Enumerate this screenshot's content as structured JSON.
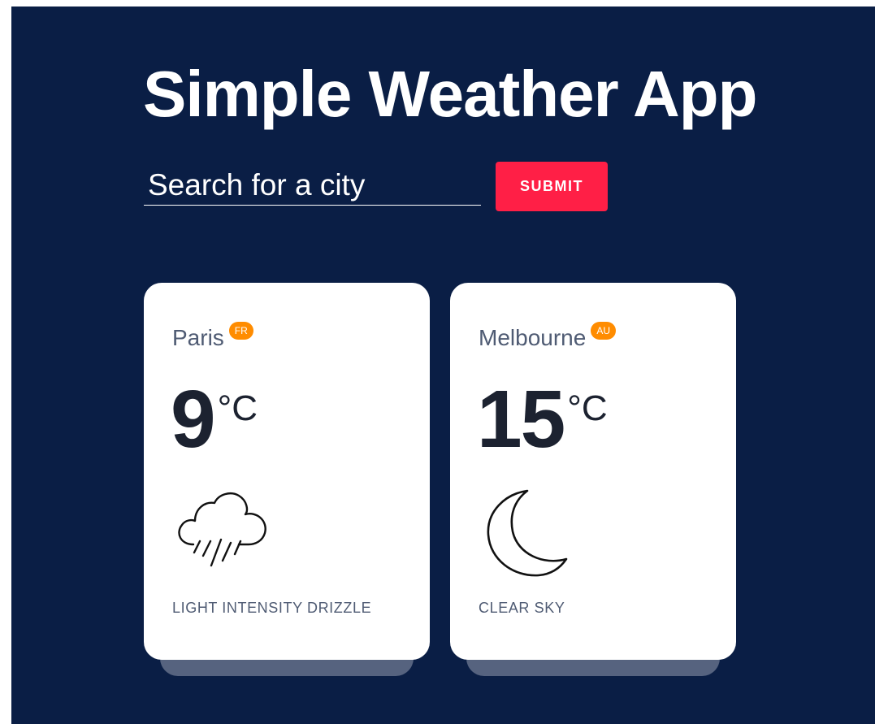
{
  "app": {
    "title": "Simple Weather App"
  },
  "search": {
    "placeholder": "Search for a city",
    "value": "",
    "submit_label": "SUBMIT"
  },
  "colors": {
    "background": "#0a1e45",
    "submit": "#ff1f46",
    "badge": "#ff8c00",
    "card": "#ffffff",
    "card_shadow": "#56637f"
  },
  "cities": [
    {
      "name": "Paris",
      "country": "FR",
      "temperature": "9",
      "unit": "°C",
      "icon": "rain-cloud-icon",
      "description": "LIGHT INTENSITY DRIZZLE"
    },
    {
      "name": "Melbourne",
      "country": "AU",
      "temperature": "15",
      "unit": "°C",
      "icon": "crescent-moon-icon",
      "description": "CLEAR SKY"
    }
  ]
}
